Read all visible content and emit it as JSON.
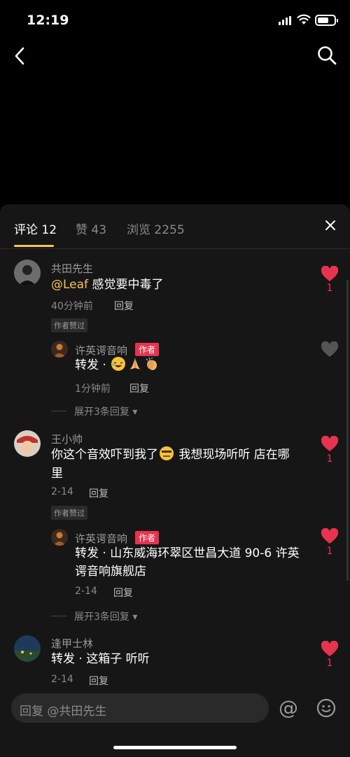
{
  "status": {
    "time": "12:19"
  },
  "tabs": [
    {
      "label": "评论 12"
    },
    {
      "label": "赞 43"
    },
    {
      "label": "浏览 2255"
    }
  ],
  "comments": [
    {
      "name": "共田先生",
      "mention": "@Leaf",
      "text": "感觉要中毒了",
      "time": "40分钟前",
      "reply": "回复",
      "badge": "作者赞过",
      "likes": "1",
      "liked": true,
      "sub": {
        "name": "许英谔音响",
        "author": "作者",
        "text": "转发 · ",
        "time": "1分钟前",
        "reply": "回复",
        "liked": false
      },
      "expand": "展开3条回复"
    },
    {
      "name": "王小帅",
      "text1": "你这个音效吓到我了",
      "text2": " 我想现场听听 店在哪",
      "text3": "里",
      "time": "2-14",
      "reply": "回复",
      "badge": "作者赞过",
      "likes": "1",
      "liked": true,
      "sub": {
        "name": "许英谔音响",
        "author": "作者",
        "line1": "转发 · 山东威海环翠区世昌大道 90-6 许英",
        "line2": "谔音响旗舰店",
        "time": "2-14",
        "reply": "回复",
        "likes": "1",
        "liked": true
      },
      "expand": "展开3条回复"
    },
    {
      "name": "逢甲士林",
      "text": "转发 · 这箱子 听听",
      "time": "2-14",
      "reply": "回复",
      "likes": "1",
      "liked": true
    }
  ],
  "input": {
    "placeholder": "回复 @共田先生"
  },
  "colors": {
    "accent": "#f6c54a",
    "like": "#e8334f",
    "sheet": "#161616"
  },
  "icons": [
    "back-icon",
    "search-icon",
    "close-icon",
    "heart-icon",
    "at-icon",
    "emoji-icon"
  ]
}
